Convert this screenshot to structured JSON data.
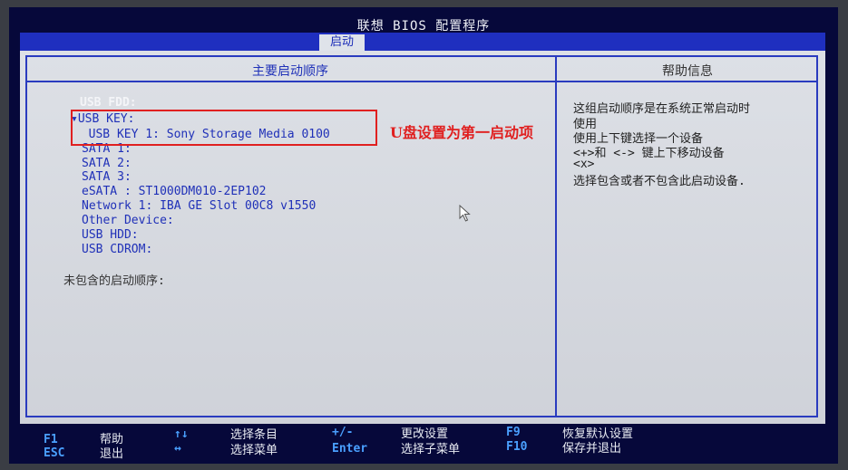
{
  "title": "联想 BIOS 配置程序",
  "tab": "启动",
  "left_header": "主要启动顺序",
  "right_header": "帮助信息",
  "boot_items": [
    "USB FDD:",
    "▾USB KEY:",
    "  USB KEY 1: Sony Storage Media 0100",
    "SATA 1:",
    "SATA 2:",
    "SATA 3:",
    "eSATA : ST1000DM010-2EP102",
    "Network 1: IBA GE Slot 00C8 v1550",
    "Other Device:",
    "USB HDD:",
    "USB CDROM:"
  ],
  "excluded_label": "未包含的启动顺序:",
  "annotation": "U盘设置为第一启动项",
  "help_lines": [
    "这组启动顺序是在系统正常启动时",
    "使用",
    "使用上下键选择一个设备",
    "<+>和 <-> 键上下移动设备",
    "<x>",
    "选择包含或者不包含此启动设备."
  ],
  "footer": {
    "f1": "F1",
    "f1_desc": "帮助",
    "esc": "ESC",
    "esc_desc": "退出",
    "updown": "↑↓",
    "updown_desc": "选择条目",
    "leftright": "↔",
    "leftright_desc": "选择菜单",
    "plusminus": "+/-",
    "plusminus_desc": "更改设置",
    "enter": "Enter",
    "enter_desc": "选择子菜单",
    "f9": "F9",
    "f9_desc": "恢复默认设置",
    "f10": "F10",
    "f10_desc": "保存并退出"
  }
}
